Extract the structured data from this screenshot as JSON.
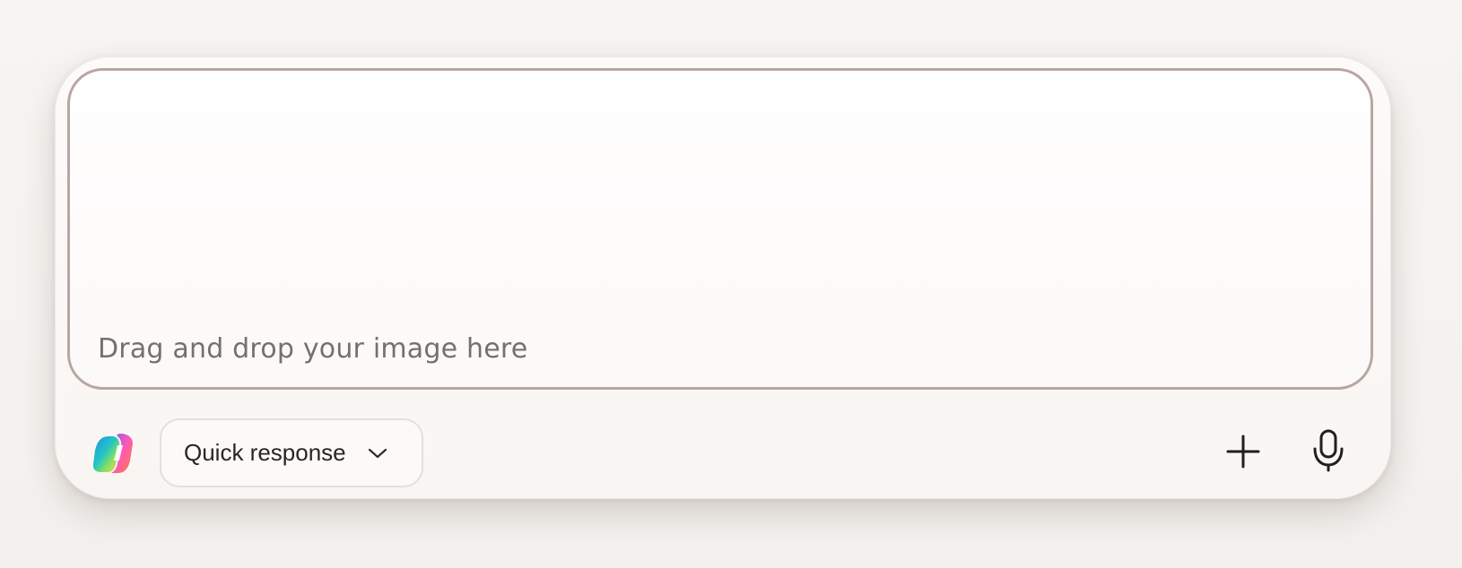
{
  "composer": {
    "placeholder": "Drag and drop your image here",
    "mode_label": "Quick response",
    "logo_icon": "copilot-logo-icon",
    "plus_icon": "plus-icon",
    "mic_icon": "microphone-icon",
    "chevron_icon": "chevron-down-icon",
    "colors": {
      "background": "#f6f3f0",
      "panel": "#fcfbfa",
      "dropzone_border": "#b9a6a1",
      "text": "#282625",
      "placeholder": "#74706d"
    }
  }
}
